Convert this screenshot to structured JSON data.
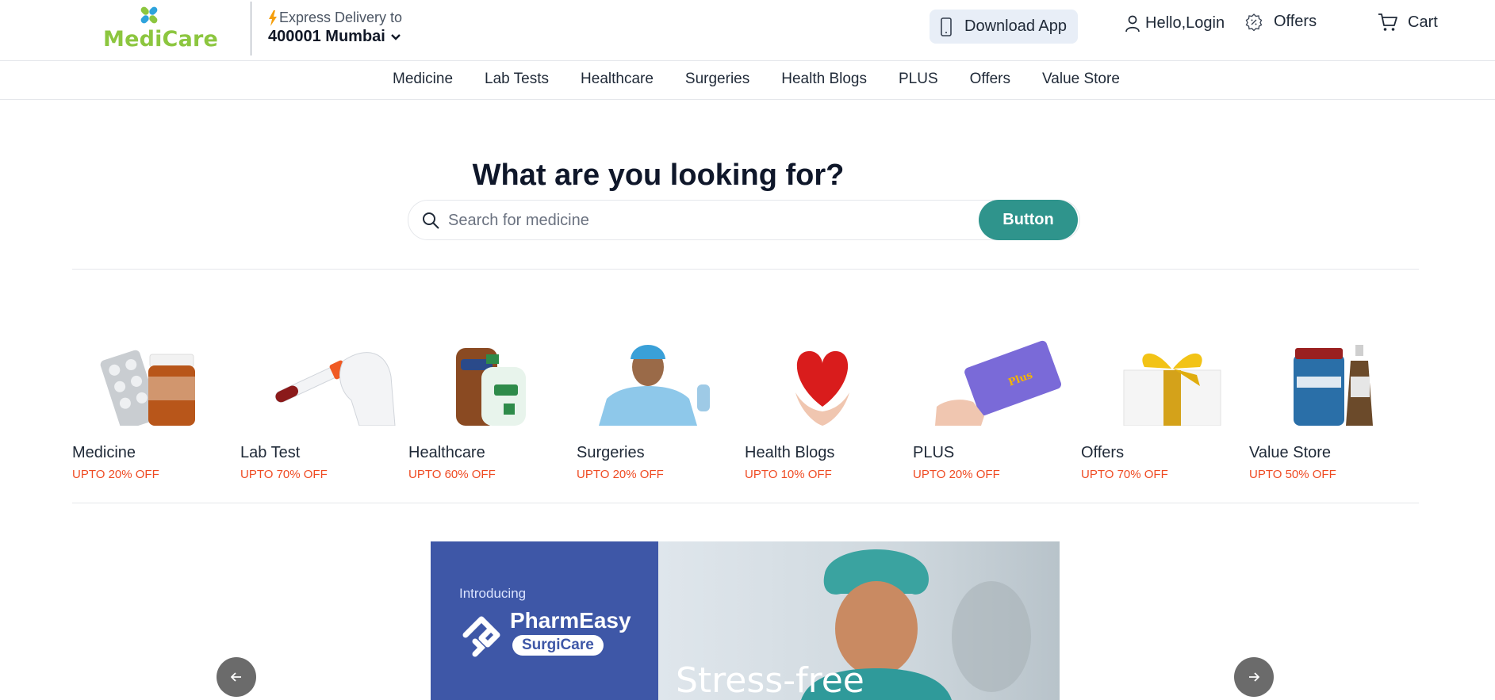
{
  "brand": {
    "name": "MediCare",
    "color": "#8cc63f"
  },
  "delivery": {
    "label": "Express Delivery to",
    "location": "400001 Mumbai"
  },
  "header": {
    "download_app": "Download App",
    "login": "Hello,Login",
    "offers": "Offers",
    "cart": "Cart"
  },
  "nav": {
    "items": [
      "Medicine",
      "Lab Tests",
      "Healthcare",
      "Surgeries",
      "Health Blogs",
      "PLUS",
      "Offers",
      "Value Store"
    ]
  },
  "hero": {
    "title": "What are you looking for?",
    "search_placeholder": "Search for medicine",
    "search_button": "Button",
    "button_color": "#2f948c"
  },
  "categories": [
    {
      "name": "Medicine",
      "offer": "UPTO 20% OFF",
      "icon": "medicine-bottle-icon"
    },
    {
      "name": "Lab Test",
      "offer": "UPTO 70% OFF",
      "icon": "test-tube-icon"
    },
    {
      "name": "Healthcare",
      "offer": "UPTO 60% OFF",
      "icon": "lotion-bottles-icon"
    },
    {
      "name": "Surgeries",
      "offer": "UPTO 20% OFF",
      "icon": "surgeon-icon"
    },
    {
      "name": "Health Blogs",
      "offer": "UPTO 10% OFF",
      "icon": "heart-hands-icon"
    },
    {
      "name": "PLUS",
      "offer": "UPTO 20% OFF",
      "icon": "plus-card-icon"
    },
    {
      "name": "Offers",
      "offer": "UPTO 70% OFF",
      "icon": "gift-box-icon"
    },
    {
      "name": "Value Store",
      "offer": "UPTO 50% OFF",
      "icon": "supplement-bottles-icon"
    }
  ],
  "offer_color": "#ef4b23",
  "banner": {
    "intro": "Introducing",
    "brand": "PharmEasy",
    "sub": "SurgiCare",
    "headline": "Stress-free"
  }
}
